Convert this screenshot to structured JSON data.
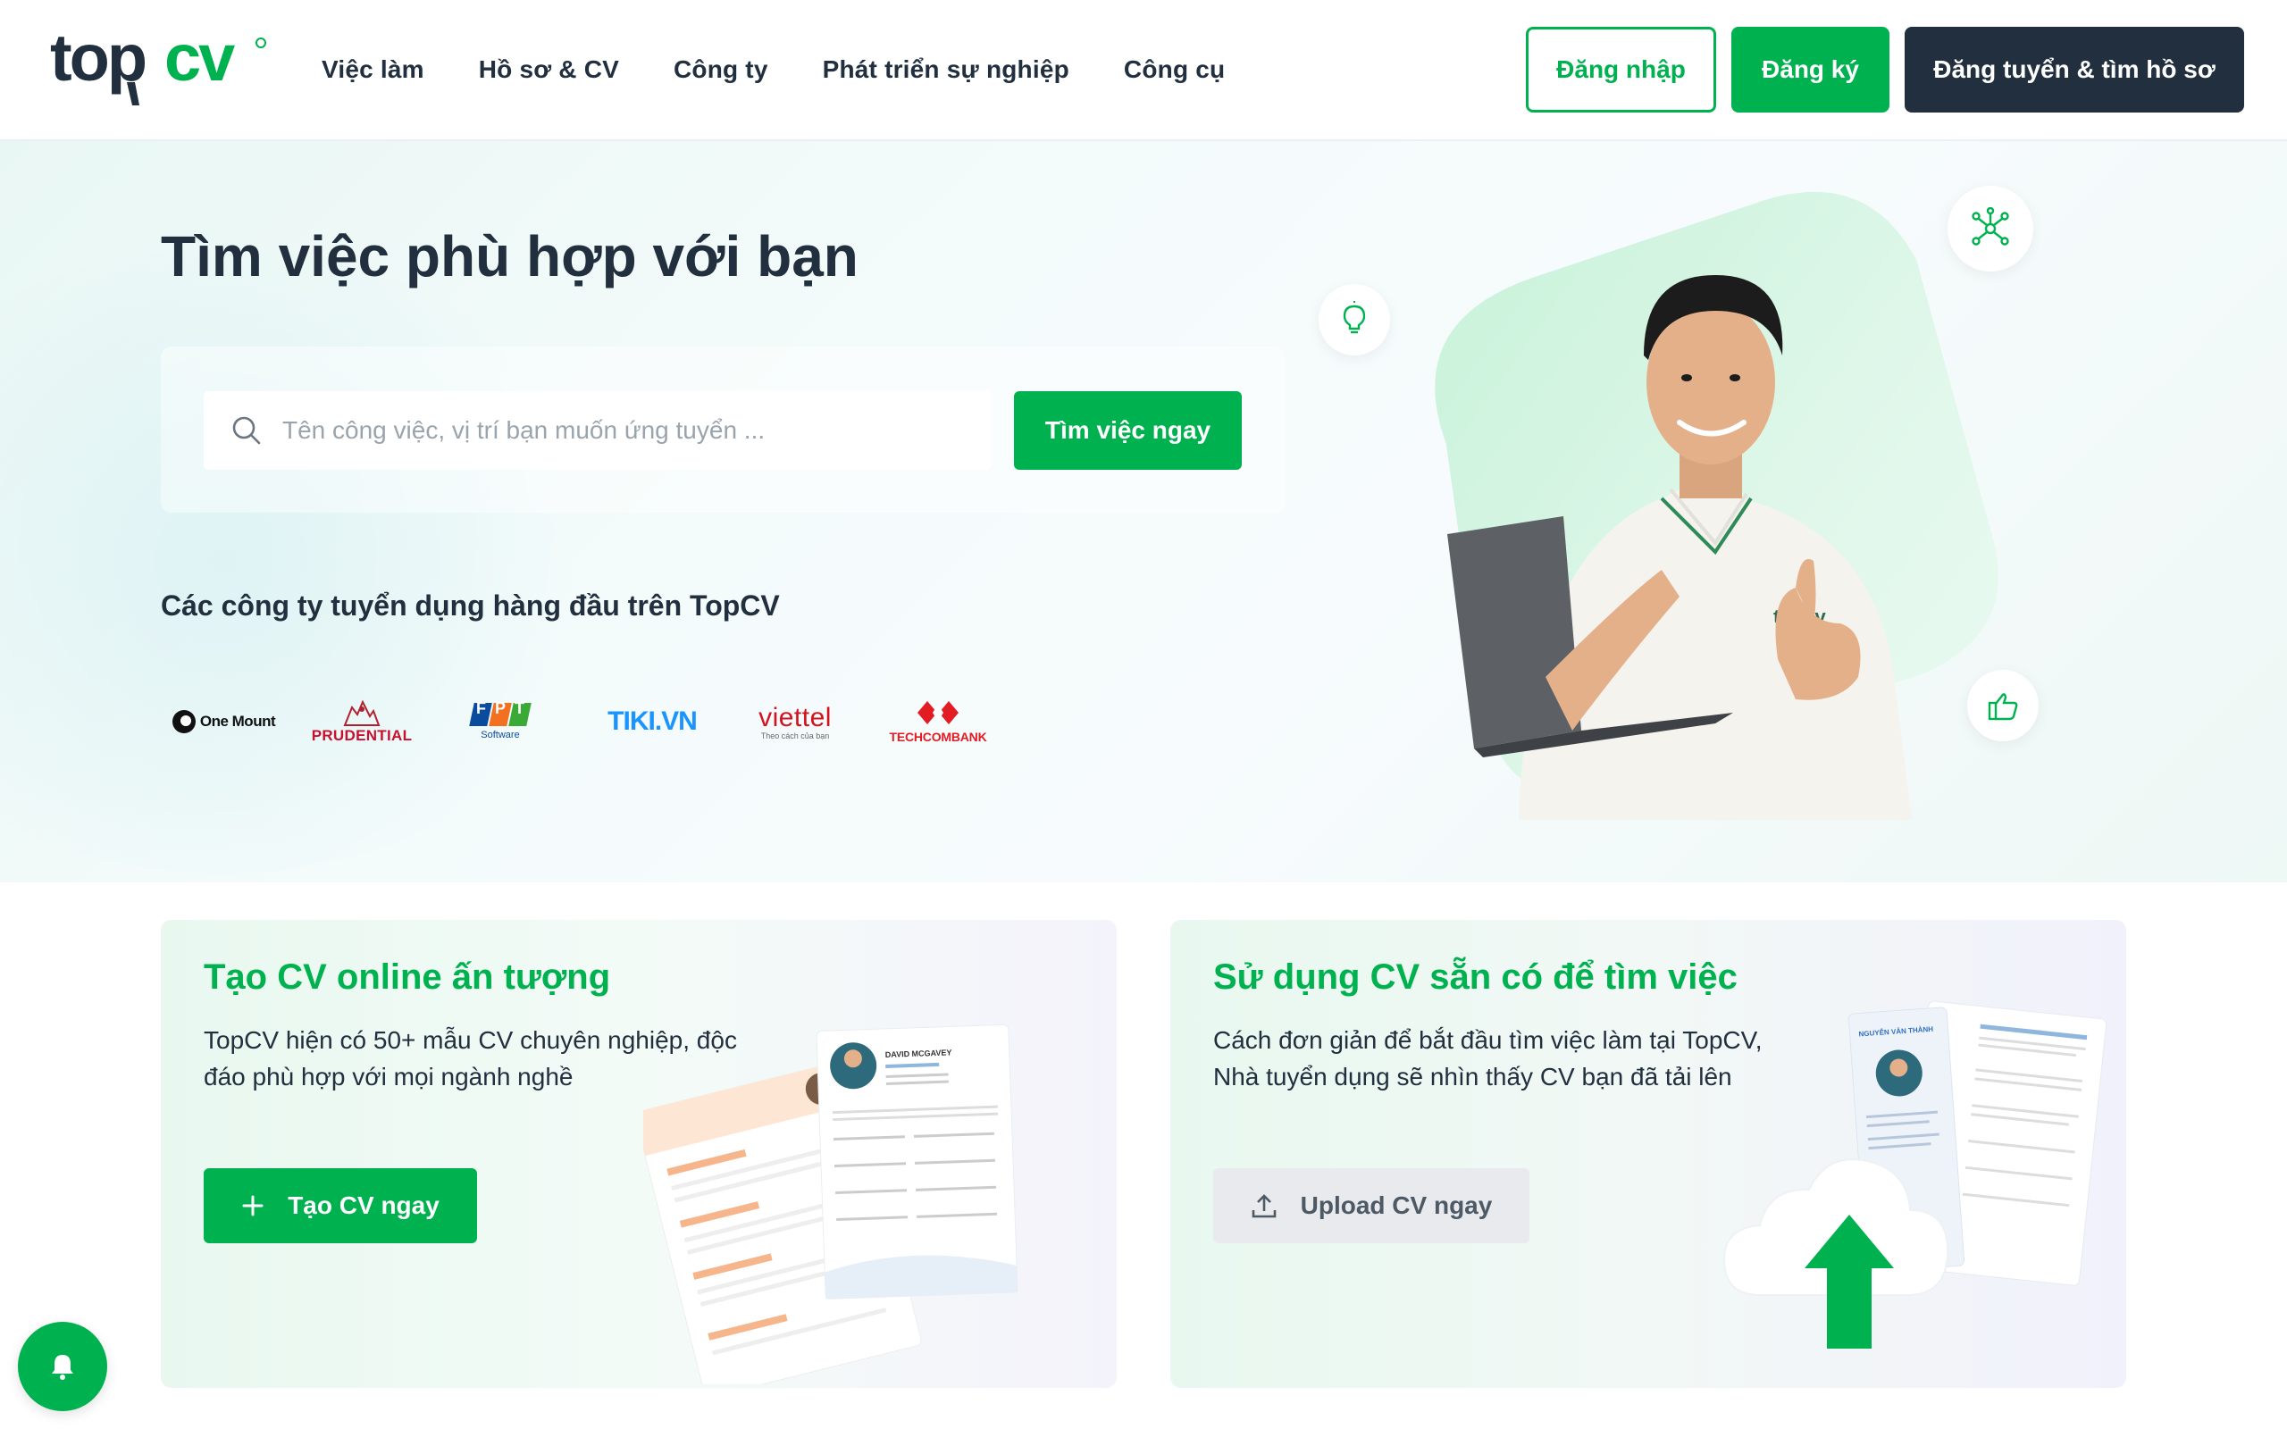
{
  "header": {
    "logo_text": "topcv",
    "nav": [
      "Việc làm",
      "Hồ sơ & CV",
      "Công ty",
      "Phát triển sự nghiệp",
      "Công cụ"
    ],
    "login_label": "Đăng nhập",
    "register_label": "Đăng ký",
    "employer_label": "Đăng tuyển & tìm hồ sơ"
  },
  "hero": {
    "title": "Tìm việc phù hợp với bạn",
    "search_placeholder": "Tên công việc, vị trí bạn muốn ứng tuyển ...",
    "search_button": "Tìm việc ngay",
    "companies_title": "Các công ty tuyển dụng hàng đầu trên TopCV",
    "companies": [
      {
        "name": "OneMount",
        "text": "One Mount"
      },
      {
        "name": "Prudential",
        "text": "PRUDENTIAL"
      },
      {
        "name": "FPT Software",
        "text": "FPT",
        "sub": "Software"
      },
      {
        "name": "Tiki",
        "text": "TIKI.VN"
      },
      {
        "name": "Viettel",
        "text": "viettel",
        "sub": "Theo cách của bạn"
      },
      {
        "name": "Techcombank",
        "text": "TECHCOMBANK"
      }
    ],
    "shirt_logo": "topcv"
  },
  "cards": {
    "create": {
      "title": "Tạo CV online ấn tượng",
      "desc": "TopCV hiện có 50+ mẫu CV chuyên nghiệp, độc đáo phù hợp với mọi ngành nghề",
      "button": "Tạo CV ngay",
      "cv_name": "DAVID MCGAVEY"
    },
    "upload": {
      "title": "Sử dụng CV sẵn có để tìm việc",
      "desc": "Cách đơn giản để bắt đầu tìm việc làm tại TopCV, Nhà tuyển dụng sẽ nhìn thấy CV bạn đã tải lên",
      "button": "Upload CV ngay",
      "cv_name": "NGUYỄN VĂN THÀNH"
    }
  },
  "colors": {
    "brand_green": "#00b14f",
    "dark": "#212f3f",
    "upload_btn_bg": "#e8eaed"
  }
}
